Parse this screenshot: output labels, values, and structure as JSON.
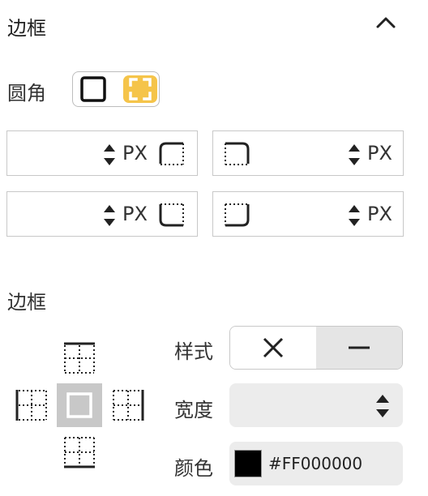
{
  "border_section": {
    "title": "边框"
  },
  "radius": {
    "label": "圆角",
    "mode_options": [
      "uniform",
      "individual"
    ],
    "selected": "individual",
    "fields": [
      {
        "corner": "top-left",
        "value": "",
        "unit": "PX"
      },
      {
        "corner": "top-right",
        "value": "",
        "unit": "PX"
      },
      {
        "corner": "bottom-left",
        "value": "",
        "unit": "PX"
      },
      {
        "corner": "bottom-right",
        "value": "",
        "unit": "PX"
      }
    ]
  },
  "border": {
    "label": "边框",
    "sides": [
      "top",
      "left",
      "all",
      "right",
      "bottom"
    ],
    "selected_side": "all",
    "style": {
      "label": "样式",
      "options": [
        "none",
        "solid"
      ],
      "selected": "solid"
    },
    "width": {
      "label": "宽度",
      "value": ""
    },
    "color": {
      "label": "颜色",
      "value": "#FF000000",
      "swatch": "#000000"
    }
  },
  "colors": {
    "accent": "#f5c44a",
    "border": "#c8c8c8",
    "field_bg": "#ececec",
    "selected_side_bg": "#c8c8c8"
  }
}
